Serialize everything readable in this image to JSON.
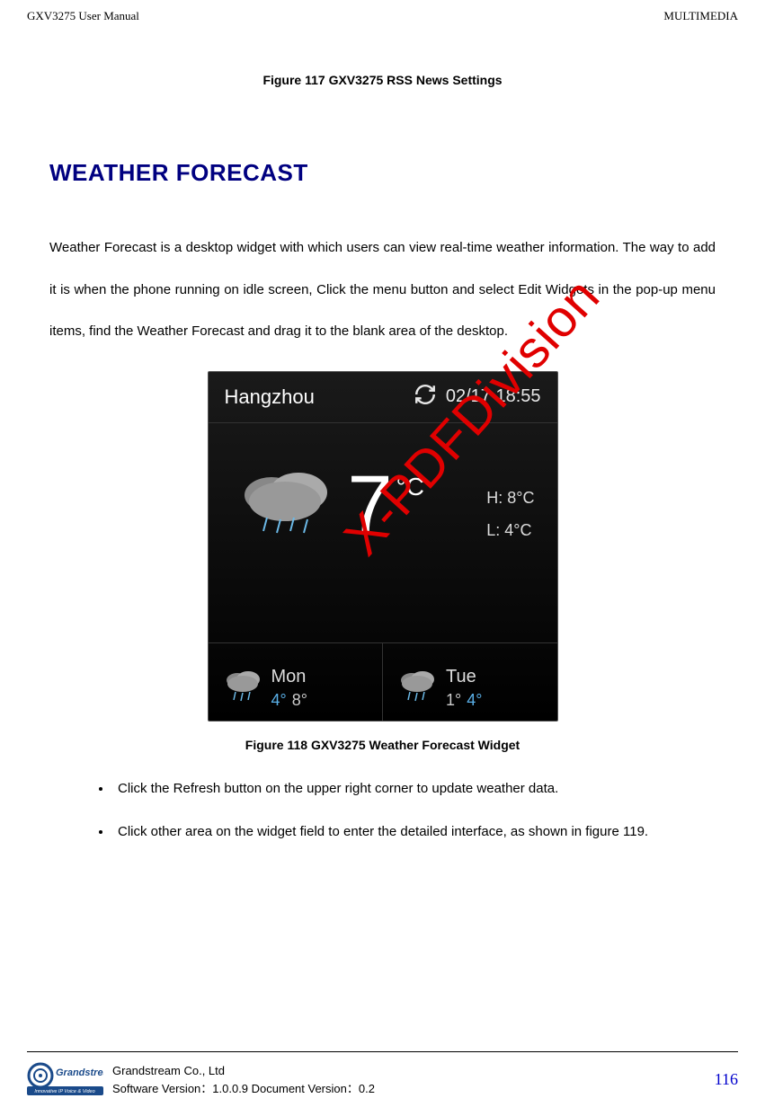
{
  "header": {
    "left": "GXV3275 User Manual",
    "right": "MULTIMEDIA"
  },
  "captions": {
    "fig117": "Figure 117 GXV3275 RSS News Settings",
    "fig118": "Figure 118 GXV3275 Weather Forecast Widget"
  },
  "section": {
    "title": "WEATHER FORECAST",
    "body": "Weather Forecast is a desktop widget with which users can view real-time weather information. The way to add it is when the phone running on idle screen, Click the menu button and select Edit Widgets in the pop-up menu items, find the Weather Forecast and drag it to the blank area of the desktop."
  },
  "widget": {
    "city": "Hangzhou",
    "datetime": "02/17 18:55",
    "temp": "7",
    "unit": "°C",
    "hi_label": "H:",
    "hi_val": "8°C",
    "lo_label": "L:",
    "lo_val": "4°C",
    "days": [
      {
        "name": "Mon",
        "lo": "4°",
        "hi": "8°"
      },
      {
        "name": "Tue",
        "lo": "1°",
        "hi": "4°"
      }
    ]
  },
  "watermark": "X-PDFDivision",
  "bullets": [
    "Click the Refresh button on the upper right corner to update weather data.",
    "Click other area on the widget field to enter the detailed interface, as shown in figure 119."
  ],
  "footer": {
    "company": "Grandstream Co., Ltd",
    "version": "Software Version：1.0.0.9 Document Version：0.2",
    "page": "116",
    "logo_top": "Grandstream",
    "logo_bottom": "Innovative IP Voice & Video"
  }
}
